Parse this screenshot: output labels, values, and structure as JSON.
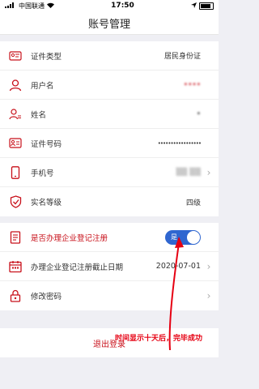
{
  "status_bar": {
    "carrier": "中国联通",
    "time": "17:50",
    "battery": "battery-icon"
  },
  "header": {
    "title": "账号管理"
  },
  "info_rows": [
    {
      "icon": "id-card-icon",
      "label": "证件类型",
      "value": "居民身份证"
    },
    {
      "icon": "user-icon",
      "label": "用户名",
      "value": "••••"
    },
    {
      "icon": "name-icon",
      "label": "姓名",
      "value": "•"
    },
    {
      "icon": "id-number-icon",
      "label": "证件号码",
      "value": "•••••••••••••••••"
    },
    {
      "icon": "phone-icon",
      "label": "手机号",
      "value": "▒▒ ▒▒"
    },
    {
      "icon": "shield-check-icon",
      "label": "实名等级",
      "value": "四级"
    }
  ],
  "enterprise": {
    "toggle_label": "是否办理企业登记注册",
    "toggle_value": "是",
    "deadline_label": "办理企业登记注册截止日期",
    "deadline_value": "2020-07-01",
    "password_label": "修改密码"
  },
  "logout_label": "退出登录",
  "annotation": "时间显示十天后，完毕成功",
  "colors": {
    "accent_red": "#c8101a",
    "toggle_blue": "#2f66d0",
    "annotation_red": "#e60012"
  }
}
